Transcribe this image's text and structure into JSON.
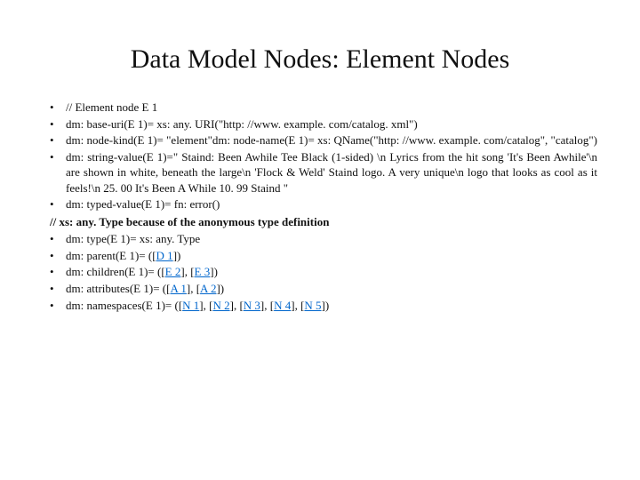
{
  "title": "Data Model Nodes: Element Nodes",
  "items": {
    "i0": "// Element node E 1",
    "i1": "dm: base-uri(E 1)= xs: any. URI(\"http: //www. example. com/catalog. xml\")",
    "i2": "dm: node-kind(E 1)= \"element\"dm: node-name(E 1)= xs: QName(\"http: //www. example. com/catalog\", \"catalog\")",
    "i3": "dm: string-value(E 1)=\" Staind: Been Awhile Tee Black (1-sided) \\n         Lyrics from the hit song 'It's Been Awhile'\\n         are shown in white, beneath the large\\n         'Flock & Weld' Staind logo. A very unique\\n         logo that looks as cool as it feels!\\n     25. 00   It's Been A While   10. 99   Staind \"",
    "i4": "dm: typed-value(E 1)= fn: error()"
  },
  "note": "// xs: any. Type because of the anonymous type definition",
  "items2": {
    "j0": "dm: type(E 1)= xs: any. Type",
    "j1_pre": "dm: parent(E 1)= ([",
    "j1_d1": "D 1",
    "j1_post": "])",
    "j2_pre": "dm: children(E 1)= ([",
    "j2_e2": "E 2",
    "j2_mid": "], [",
    "j2_e3": "E 3",
    "j2_post": "])",
    "j3_pre": "dm: attributes(E 1)= ([",
    "j3_a1": "A 1",
    "j3_mid": "], [",
    "j3_a2": "A 2",
    "j3_post": "])",
    "j4_pre": "dm: namespaces(E 1)= ([",
    "j4_n1": "N 1",
    "j4_s1": "], [",
    "j4_n2": "N 2",
    "j4_s2": "], [",
    "j4_n3": "N 3",
    "j4_s3": "], [",
    "j4_n4": "N 4",
    "j4_s4": "], [",
    "j4_n5": "N 5",
    "j4_post": "])"
  }
}
